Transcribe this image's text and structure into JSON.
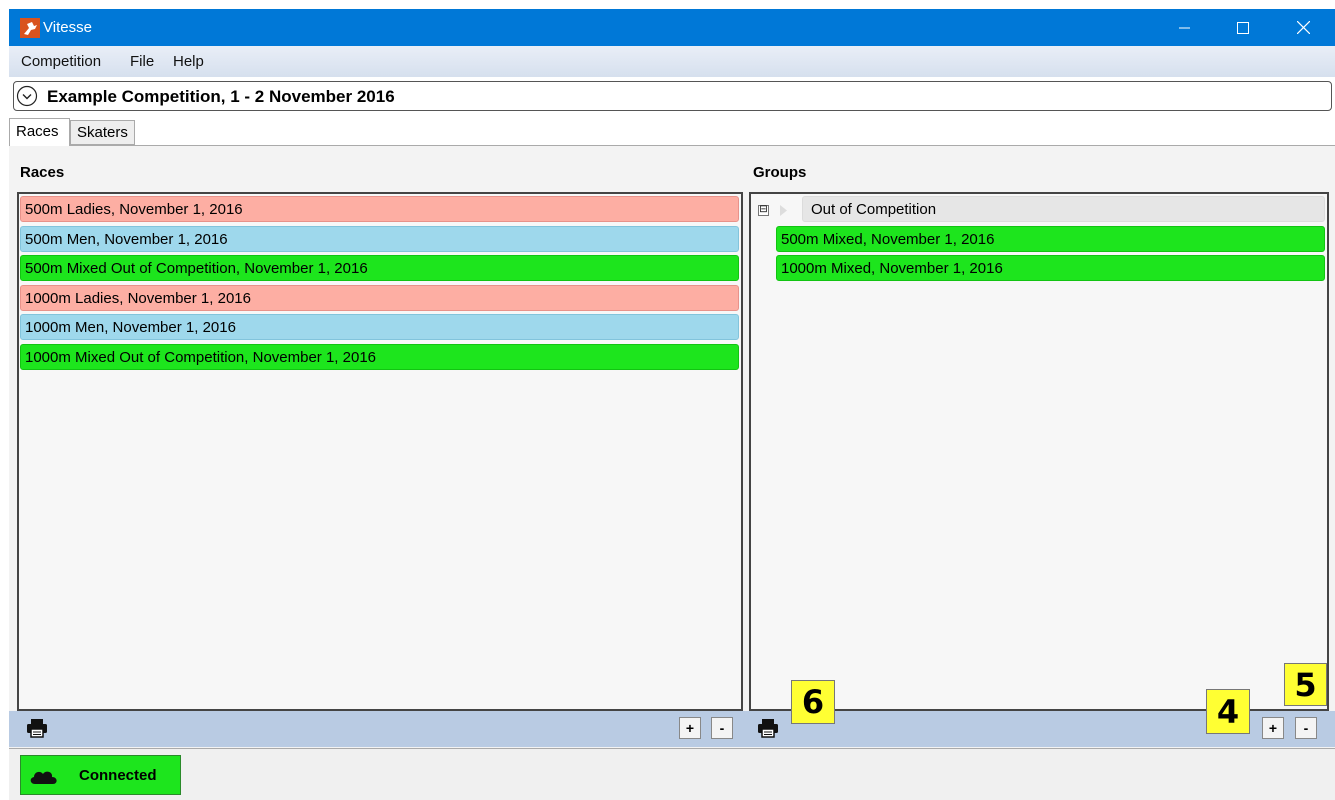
{
  "window": {
    "title": "Vitesse",
    "minimize_label": "—",
    "maximize_label": "☐",
    "close_label": "✕"
  },
  "menu": [
    "Competition",
    "File",
    "Help"
  ],
  "competition": {
    "title": "Example Competition, 1 - 2 November 2016"
  },
  "tabs": [
    "Races",
    "Skaters"
  ],
  "races": {
    "label": "Races",
    "items": [
      {
        "text": "500m Ladies, November 1, 2016",
        "kind": "ladies"
      },
      {
        "text": "500m Men, November 1, 2016",
        "kind": "men"
      },
      {
        "text": "500m Mixed Out of Competition, November 1, 2016",
        "kind": "mixed"
      },
      {
        "text": "1000m Ladies, November 1, 2016",
        "kind": "ladies"
      },
      {
        "text": "1000m Men, November 1, 2016",
        "kind": "men"
      },
      {
        "text": "1000m Mixed Out of Competition, November 1, 2016",
        "kind": "mixed"
      }
    ],
    "add_label": "+",
    "remove_label": "-"
  },
  "groups": {
    "label": "Groups",
    "group_name": "Out of Competition",
    "expand_symbol": "⊟",
    "items": [
      "500m Mixed, November 1, 2016",
      "1000m Mixed, November 1, 2016"
    ],
    "add_label": "+",
    "remove_label": "-"
  },
  "callouts": [
    "6",
    "4",
    "5"
  ],
  "status": {
    "label": "Connected"
  },
  "colors": {
    "titlebar": "#0078d7",
    "ladies": "#fdaea3",
    "men": "#9ed8ec",
    "mixed": "#1de51d",
    "callout": "#ffff33"
  }
}
